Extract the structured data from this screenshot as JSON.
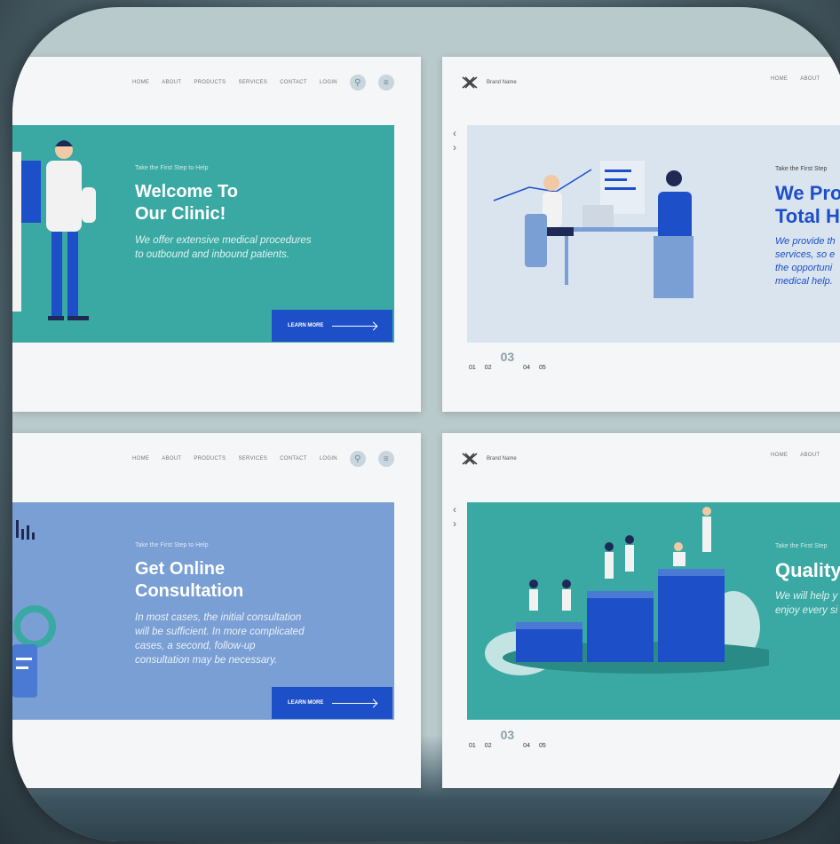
{
  "nav": {
    "items": [
      "HOME",
      "ABOUT",
      "PRODUCTS",
      "SERVICES",
      "CONTACT",
      "LOGIN"
    ],
    "short_items": [
      "HOME",
      "ABOUT"
    ]
  },
  "brand_name": "Brand Name",
  "panels": {
    "p1": {
      "kicker": "Take the First Step to Help",
      "title_line1": "Welcome To",
      "title_line2": "Our Clinic!",
      "desc_line1": "We offer extensive medical procedures",
      "desc_line2": "to outbound and inbound patients.",
      "button": "LEARN MORE"
    },
    "p2": {
      "kicker": "Take the First Step",
      "title_line1": "We Pro",
      "title_line2": "Total H",
      "desc_line1": "We provide th",
      "desc_line2": "services, so e",
      "desc_line3": "the opportuni",
      "desc_line4": "medical help."
    },
    "p3": {
      "kicker": "Take the First Step to Help",
      "title_line1": "Get Online",
      "title_line2": "Consultation",
      "desc_line1": "In most cases, the initial consultation",
      "desc_line2": "will be sufficient. In more complicated",
      "desc_line3": "cases, a second, follow-up",
      "desc_line4": "consultation may be necessary.",
      "button": "LEARN MORE"
    },
    "p4": {
      "kicker": "Take the First Step",
      "title_line1": "Quality",
      "desc_line1": "We will help y",
      "desc_line2": "enjoy every si"
    }
  },
  "pager": {
    "p1": "01",
    "p2": "02",
    "current": "03",
    "p4": "04",
    "p5": "05"
  },
  "colors": {
    "teal": "#3aa9a3",
    "blue": "#1d4fc9",
    "periwinkle": "#7a9fd4",
    "lightblue": "#d9e4ef"
  }
}
